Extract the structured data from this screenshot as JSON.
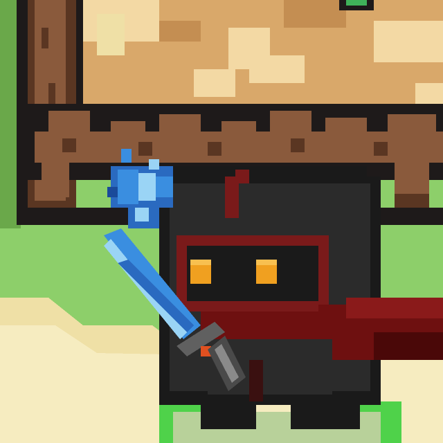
{
  "scene": {
    "description_free": true,
    "colors": {
      "grass": "#8dcf6a",
      "grass_dark": "#6aa84a",
      "sand": "#efe0a6",
      "sand_light": "#f6ecc0",
      "wood": "#8a5a3c",
      "wood_dark": "#5a3622",
      "outline": "#1e1a1a",
      "table_top": "#d9a86a",
      "table_top_light": "#f3d9a4",
      "knight_body": "#2b2b2b",
      "knight_dark": "#1a1a1a",
      "knight_red": "#7a1a1a",
      "scarf": "#6e1010",
      "eyes": "#f0a020",
      "sword_blue": "#3a8ee0",
      "sword_light": "#9ad4f5",
      "sword_handle": "#606060",
      "shadow_green": "#4fd24a"
    },
    "icons": [
      "wooden-table-icon",
      "knight-character-icon",
      "ice-sword-icon",
      "crystal-shard-icon"
    ]
  }
}
